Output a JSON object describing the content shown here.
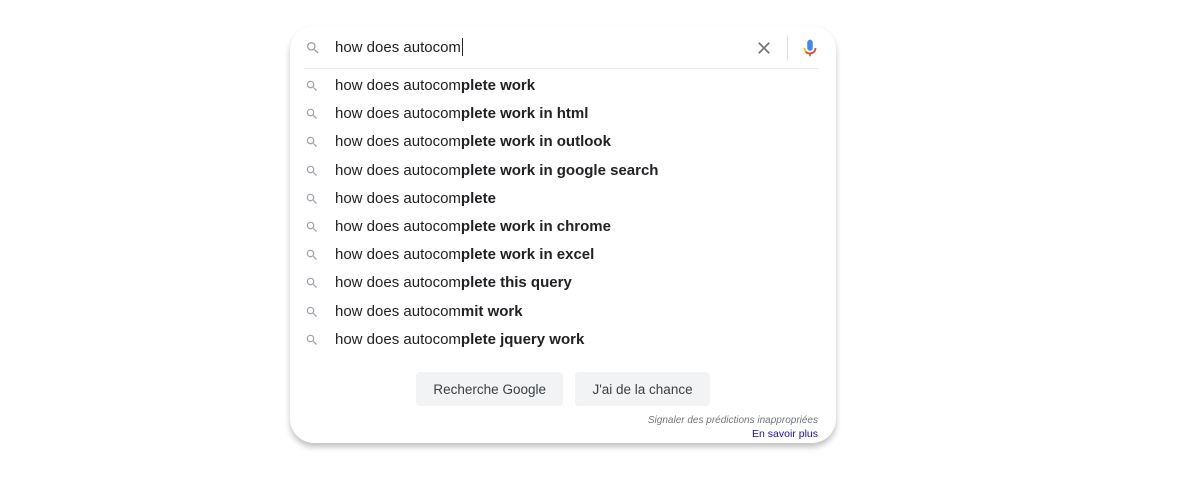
{
  "search": {
    "query": "how does autocom",
    "icon": "search-icon",
    "clear_icon": "close-icon",
    "mic_icon": "microphone-icon"
  },
  "suggestions": [
    {
      "prefix": "how does autocom",
      "completion": "plete work"
    },
    {
      "prefix": "how does autocom",
      "completion": "plete work in html"
    },
    {
      "prefix": "how does autocom",
      "completion": "plete work in outlook"
    },
    {
      "prefix": "how does autocom",
      "completion": "plete work in google search"
    },
    {
      "prefix": "how does autocom",
      "completion": "plete"
    },
    {
      "prefix": "how does autocom",
      "completion": "plete work in chrome"
    },
    {
      "prefix": "how does autocom",
      "completion": "plete work in excel"
    },
    {
      "prefix": "how does autocom",
      "completion": "plete this query"
    },
    {
      "prefix": "how does autocom",
      "completion": "mit work"
    },
    {
      "prefix": "how does autocom",
      "completion": "plete jquery work"
    }
  ],
  "buttons": {
    "search_label": "Recherche Google",
    "lucky_label": "J'ai de la chance"
  },
  "footer": {
    "report_text": "Signaler des prédictions inappropriées",
    "learn_more": "En savoir plus"
  },
  "colors": {
    "text": "#202124",
    "icon_gray": "#9aa0a6",
    "link": "#1a0dab",
    "mic_blue": "#4285f4",
    "mic_red": "#ea4335",
    "mic_yellow": "#fbbc04",
    "mic_green": "#34a853"
  }
}
